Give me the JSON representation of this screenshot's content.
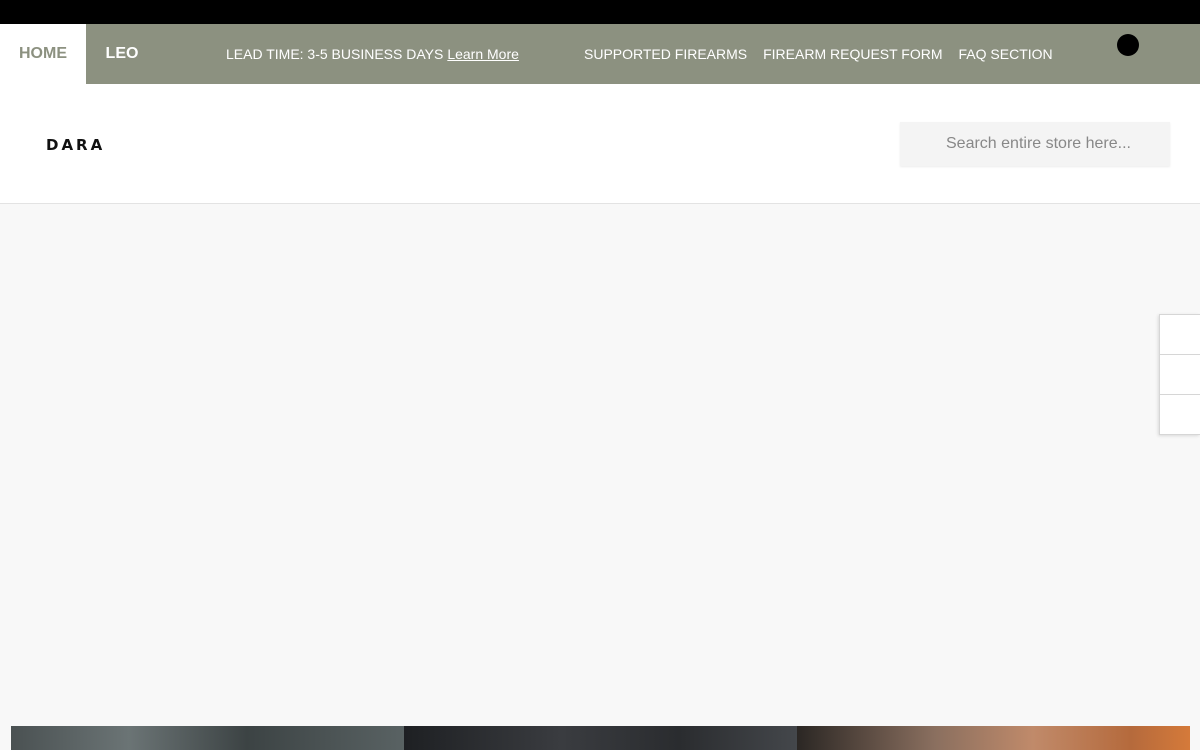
{
  "nav": {
    "home_label": "HOME",
    "leo_label": "LEO",
    "lead_time_text": "LEAD TIME: 3-5 BUSINESS DAYS",
    "learn_more_label": "Learn More",
    "links": [
      {
        "label": "SUPPORTED FIREARMS"
      },
      {
        "label": "FIREARM REQUEST FORM"
      },
      {
        "label": "FAQ SECTION"
      }
    ]
  },
  "header": {
    "logo_text": "DARA",
    "search": {
      "placeholder": "Search entire store here...",
      "value": ""
    }
  },
  "colors": {
    "nav_background": "#8c9180",
    "top_bar": "#000000",
    "page_background": "#f8f8f8"
  }
}
